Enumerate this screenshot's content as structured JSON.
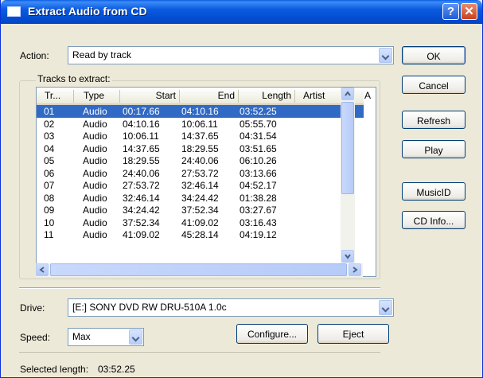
{
  "window": {
    "title": "Extract Audio from CD",
    "help_label": "?",
    "close_label": "✕"
  },
  "action": {
    "label": "Action:",
    "value": "Read by track"
  },
  "tracks": {
    "label": "Tracks to extract:",
    "columns": [
      "Tr...",
      "Type",
      "Start",
      "End",
      "Length",
      "Artist",
      "A"
    ],
    "rows": [
      [
        "01",
        "Audio",
        "00:17.66",
        "04:10.16",
        "03:52.25"
      ],
      [
        "02",
        "Audio",
        "04:10.16",
        "10:06.11",
        "05:55.70"
      ],
      [
        "03",
        "Audio",
        "10:06.11",
        "14:37.65",
        "04:31.54"
      ],
      [
        "04",
        "Audio",
        "14:37.65",
        "18:29.55",
        "03:51.65"
      ],
      [
        "05",
        "Audio",
        "18:29.55",
        "24:40.06",
        "06:10.26"
      ],
      [
        "06",
        "Audio",
        "24:40.06",
        "27:53.72",
        "03:13.66"
      ],
      [
        "07",
        "Audio",
        "27:53.72",
        "32:46.14",
        "04:52.17"
      ],
      [
        "08",
        "Audio",
        "32:46.14",
        "34:24.42",
        "01:38.28"
      ],
      [
        "09",
        "Audio",
        "34:24.42",
        "37:52.34",
        "03:27.67"
      ],
      [
        "10",
        "Audio",
        "37:52.34",
        "41:09.02",
        "03:16.43"
      ],
      [
        "11",
        "Audio",
        "41:09.02",
        "45:28.14",
        "04:19.12"
      ]
    ],
    "selected_index": 0
  },
  "buttons": {
    "ok": "OK",
    "cancel": "Cancel",
    "refresh": "Refresh",
    "play": "Play",
    "musicid": "MusicID",
    "cdinfo": "CD Info...",
    "configure": "Configure...",
    "eject": "Eject"
  },
  "drive": {
    "label": "Drive:",
    "value": "[E:] SONY DVD RW DRU-510A 1.0c"
  },
  "speed": {
    "label": "Speed:",
    "value": "Max"
  },
  "status": {
    "label": "Selected length:",
    "value": "03:52.25"
  },
  "colors": {
    "selection": "#316AC5",
    "titlebar": "#0A5AE0",
    "dialog_bg": "#ECE9D8"
  }
}
